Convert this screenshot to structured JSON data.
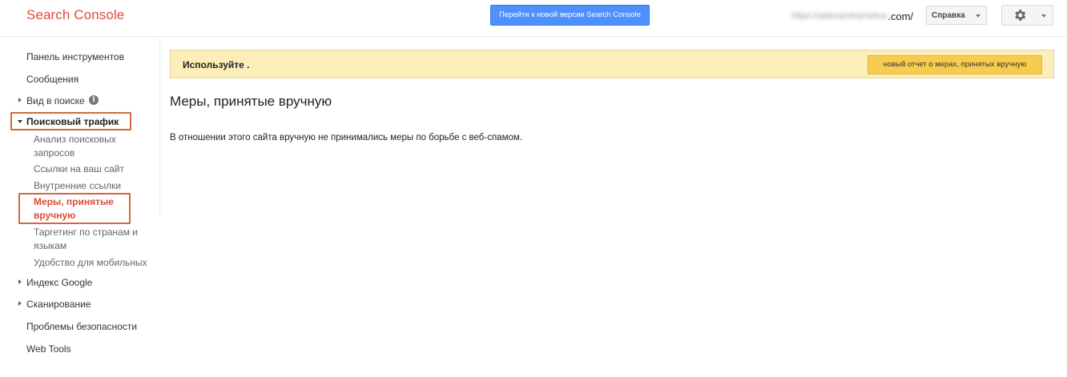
{
  "header": {
    "logo": "Search Console",
    "new_version_button": "Перейти к новой версии Search Console",
    "site_url_blurred": "https://aleksandrametica",
    "site_url_suffix": ".com/",
    "help_label": "Справка",
    "settings_icon": "gear-icon"
  },
  "sidebar": {
    "dashboard": "Панель инструментов",
    "messages": "Сообщения",
    "search_appearance": "Вид в поиске",
    "search_appearance_info": "i",
    "search_traffic": "Поисковый трафик",
    "search_analytics": "Анализ поисковых запросов",
    "search_analytics_lines": [
      "Анализ поисковых",
      "запросов"
    ],
    "links_to_site": "Ссылки на ваш сайт",
    "internal_links": "Внутренние ссылки",
    "manual_actions_lines": [
      "Меры, принятые",
      "вручную"
    ],
    "intl_targeting_lines": [
      "Таргетинг по странам и",
      "языкам"
    ],
    "mobile_usability": "Удобство для мобильных",
    "google_index": "Индекс Google",
    "crawl": "Сканирование",
    "security_issues": "Проблемы безопасности",
    "web_tools": "Web Tools"
  },
  "banner": {
    "text": "Используйте .",
    "button": "новый отчет о мерах, принятых вручную"
  },
  "main": {
    "title": "Меры, принятые вручную",
    "message": "В отношении этого сайта вручную не принимались меры по борьбе с веб-спамом."
  },
  "colors": {
    "logo": "#dd4b39",
    "active_nav": "#dd4b39",
    "highlight_box": "#d2693e",
    "primary_button": "#4d90fe",
    "banner_bg": "#fbeeb8",
    "banner_button": "#f7cb4d"
  }
}
